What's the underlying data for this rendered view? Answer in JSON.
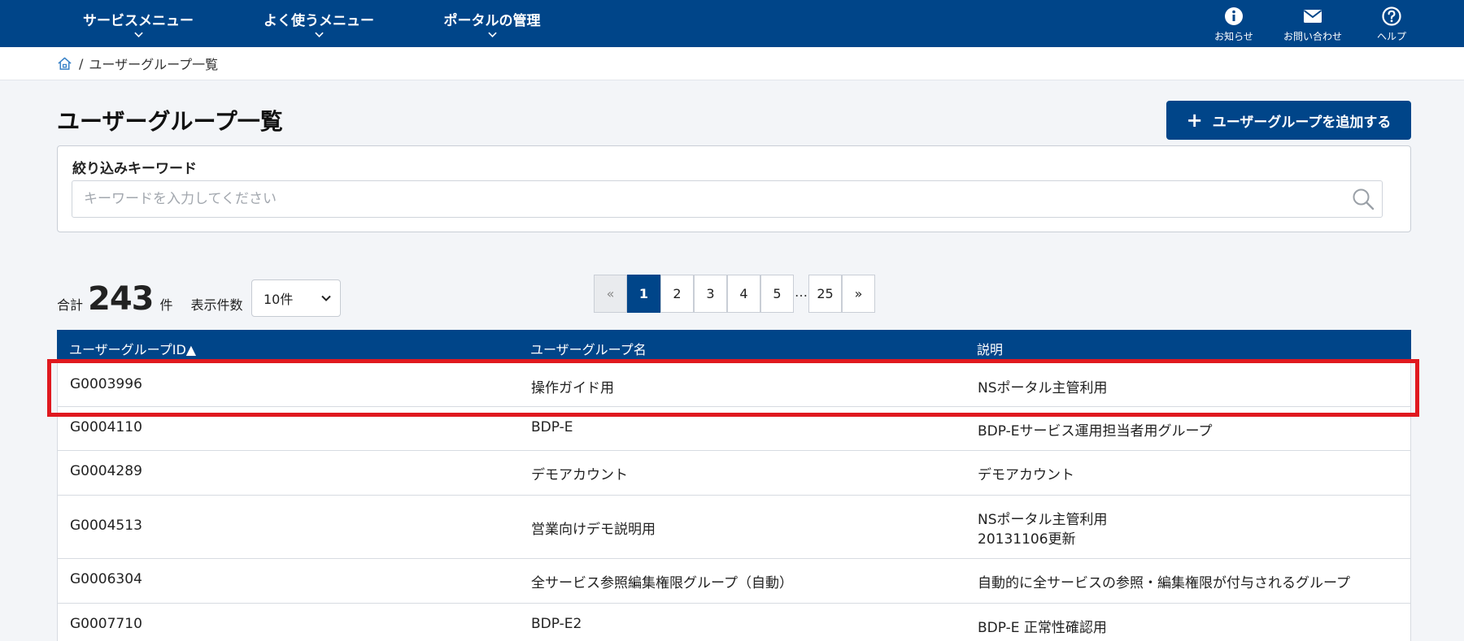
{
  "nav": {
    "menus": [
      {
        "label": "サービスメニュー"
      },
      {
        "label": "よく使うメニュー"
      },
      {
        "label": "ポータルの管理"
      }
    ],
    "utilities": [
      {
        "label": "お知らせ",
        "icon": "info-icon"
      },
      {
        "label": "お問い合わせ",
        "icon": "mail-icon"
      },
      {
        "label": "ヘルプ",
        "icon": "help-icon"
      }
    ]
  },
  "breadcrumb": {
    "separator": "/",
    "current": "ユーザーグループ一覧"
  },
  "page": {
    "title": "ユーザーグループ一覧",
    "add_button": "ユーザーグループを追加する",
    "add_icon": "+"
  },
  "filter": {
    "label": "絞り込みキーワード",
    "placeholder": "キーワードを入力してください",
    "value": ""
  },
  "summary": {
    "total_prefix": "合計",
    "total": "243",
    "total_unit": "件",
    "per_page_label": "表示件数",
    "per_page_value": "10件"
  },
  "pagination": {
    "prev": "«",
    "pages": [
      "1",
      "2",
      "3",
      "4",
      "5"
    ],
    "ellipsis": "…",
    "last": "25",
    "next": "»",
    "current": "1"
  },
  "table": {
    "headers": [
      "ユーザーグループID▲",
      "ユーザーグループ名",
      "説明"
    ],
    "rows": [
      {
        "id": "G0003996",
        "name": "操作ガイド用",
        "desc": "NSポータル主管利用",
        "desc2": ""
      },
      {
        "id": "G0004110",
        "name": "BDP-E",
        "desc": "BDP-Eサービス運用担当者用グループ",
        "desc2": ""
      },
      {
        "id": "G0004289",
        "name": "デモアカウント",
        "desc": "デモアカウント",
        "desc2": ""
      },
      {
        "id": "G0004513",
        "name": "営業向けデモ説明用",
        "desc": "NSポータル主管利用",
        "desc2": "20131106更新"
      },
      {
        "id": "G0006304",
        "name": "全サービス参照編集権限グループ（自動）",
        "desc": "自動的に全サービスの参照・編集権限が付与されるグループ",
        "desc2": ""
      },
      {
        "id": "G0007710",
        "name": "BDP-E2",
        "desc": "BDP-E 正常性確認用",
        "desc2": ""
      }
    ]
  },
  "colors": {
    "brand": "#004589",
    "highlight": "#e0191f"
  }
}
